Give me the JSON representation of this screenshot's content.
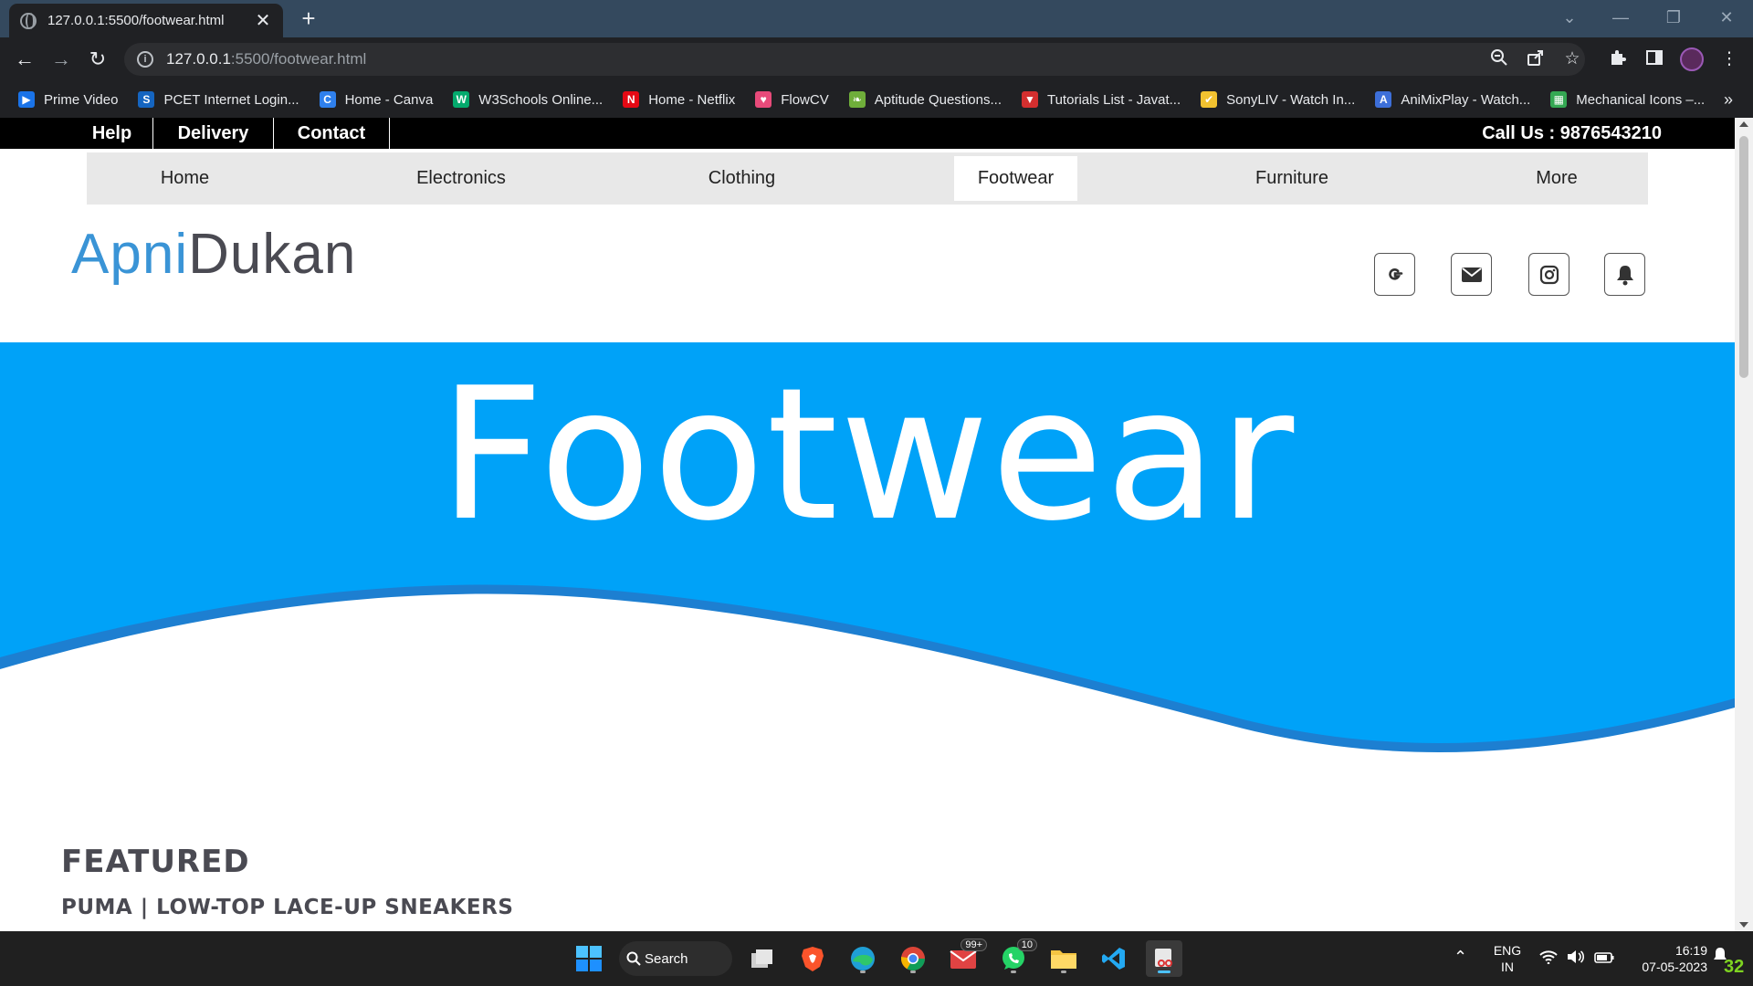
{
  "browser": {
    "tab_title": "127.0.0.1:5500/footwear.html",
    "tab_close": "✕",
    "new_tab": "+",
    "url_host": "127.0.0.1",
    "url_path": ":5500/footwear.html",
    "back": "←",
    "forward": "→",
    "reload": "↻",
    "bookmarks": [
      {
        "label": "Prime Video",
        "color": "#1a73e8"
      },
      {
        "label": "PCET Internet Login...",
        "color": "#1565c0"
      },
      {
        "label": "Home - Canva",
        "color": "#2f80ed"
      },
      {
        "label": "W3Schools Online...",
        "color": "#04aa6d"
      },
      {
        "label": "Home - Netflix",
        "color": "#e50914"
      },
      {
        "label": "FlowCV",
        "color": "#e84a7a"
      },
      {
        "label": "Aptitude Questions...",
        "color": "#6fae3a"
      },
      {
        "label": "Tutorials List - Javat...",
        "color": "#d32f2f"
      },
      {
        "label": "SonyLIV - Watch In...",
        "color": "#f2c230"
      },
      {
        "label": "AniMixPlay - Watch...",
        "color": "#3d6fd9"
      },
      {
        "label": "Mechanical Icons –...",
        "color": "#34a853"
      }
    ],
    "bookmarks_more": "»"
  },
  "page": {
    "topbar": {
      "links": [
        "Help",
        "Delivery",
        "Contact"
      ],
      "call": "Call Us : 9876543210"
    },
    "nav": {
      "items": [
        "Home",
        "Electronics",
        "Clothing",
        "Footwear",
        "Furniture",
        "More"
      ],
      "active": "Footwear"
    },
    "logo": {
      "part1": "Apni",
      "part2": "Dukan"
    },
    "social_icons": [
      "google-icon",
      "mail-icon",
      "instagram-icon",
      "bell-icon"
    ],
    "hero": {
      "title": "Footwear",
      "color": "#00a2f8",
      "wave_color": "#1d7fd1"
    },
    "featured_heading": "FEATURED",
    "product_title": "PUMA | LOW-TOP LACE-UP SNEAKERS"
  },
  "taskbar": {
    "search_label": "Search",
    "mail_badge": "99+",
    "whatsapp_badge": "10",
    "lang_line1": "ENG",
    "lang_line2": "IN",
    "time": "16:19",
    "date": "07-05-2023",
    "corner_number": "32"
  }
}
